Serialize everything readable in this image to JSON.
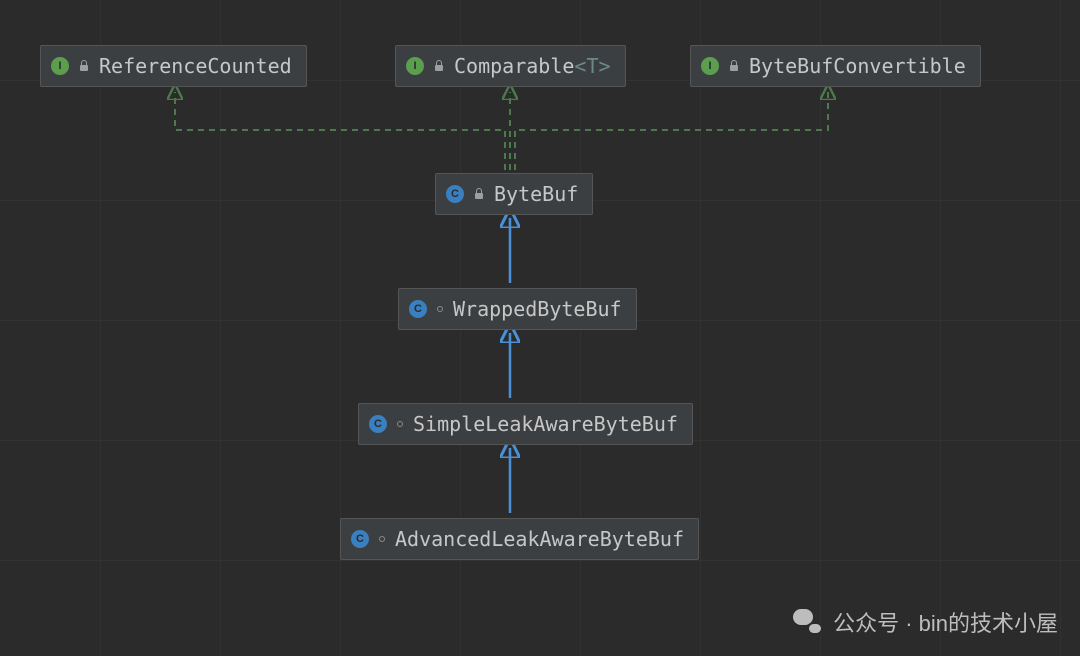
{
  "diagram": {
    "nodes": {
      "refCounted": {
        "label": "ReferenceCounted",
        "kind": "interface",
        "access": "lock"
      },
      "comparable": {
        "label": "Comparable",
        "generic": "<T>",
        "kind": "interface",
        "access": "lock"
      },
      "convertible": {
        "label": "ByteBufConvertible",
        "kind": "interface",
        "access": "lock"
      },
      "byteBuf": {
        "label": "ByteBuf",
        "kind": "class",
        "access": "lock"
      },
      "wrapped": {
        "label": "WrappedByteBuf",
        "kind": "class",
        "access": "dot"
      },
      "simpleLeak": {
        "label": "SimpleLeakAwareByteBuf",
        "kind": "class",
        "access": "dot"
      },
      "advLeak": {
        "label": "AdvancedLeakAwareByteBuf",
        "kind": "class",
        "access": "dot"
      }
    },
    "edges": [
      {
        "from": "byteBuf",
        "to": "refCounted",
        "style": "implements"
      },
      {
        "from": "byteBuf",
        "to": "comparable",
        "style": "implements"
      },
      {
        "from": "byteBuf",
        "to": "convertible",
        "style": "implements"
      },
      {
        "from": "wrapped",
        "to": "byteBuf",
        "style": "extends"
      },
      {
        "from": "simpleLeak",
        "to": "wrapped",
        "style": "extends"
      },
      {
        "from": "advLeak",
        "to": "simpleLeak",
        "style": "extends"
      }
    ]
  },
  "icons": {
    "interface_letter": "I",
    "class_letter": "C"
  },
  "colors": {
    "bg": "#2b2b2b",
    "node_bg": "#3c3f41",
    "node_border": "#555555",
    "text": "#c7c7c7",
    "interface_icon": "#5b9e4d",
    "class_icon": "#3a7fbf",
    "implements_arrow": "#4b7a4b",
    "extends_arrow": "#4a90d9"
  },
  "watermark": {
    "text": "公众号 · bin的技术小屋"
  }
}
